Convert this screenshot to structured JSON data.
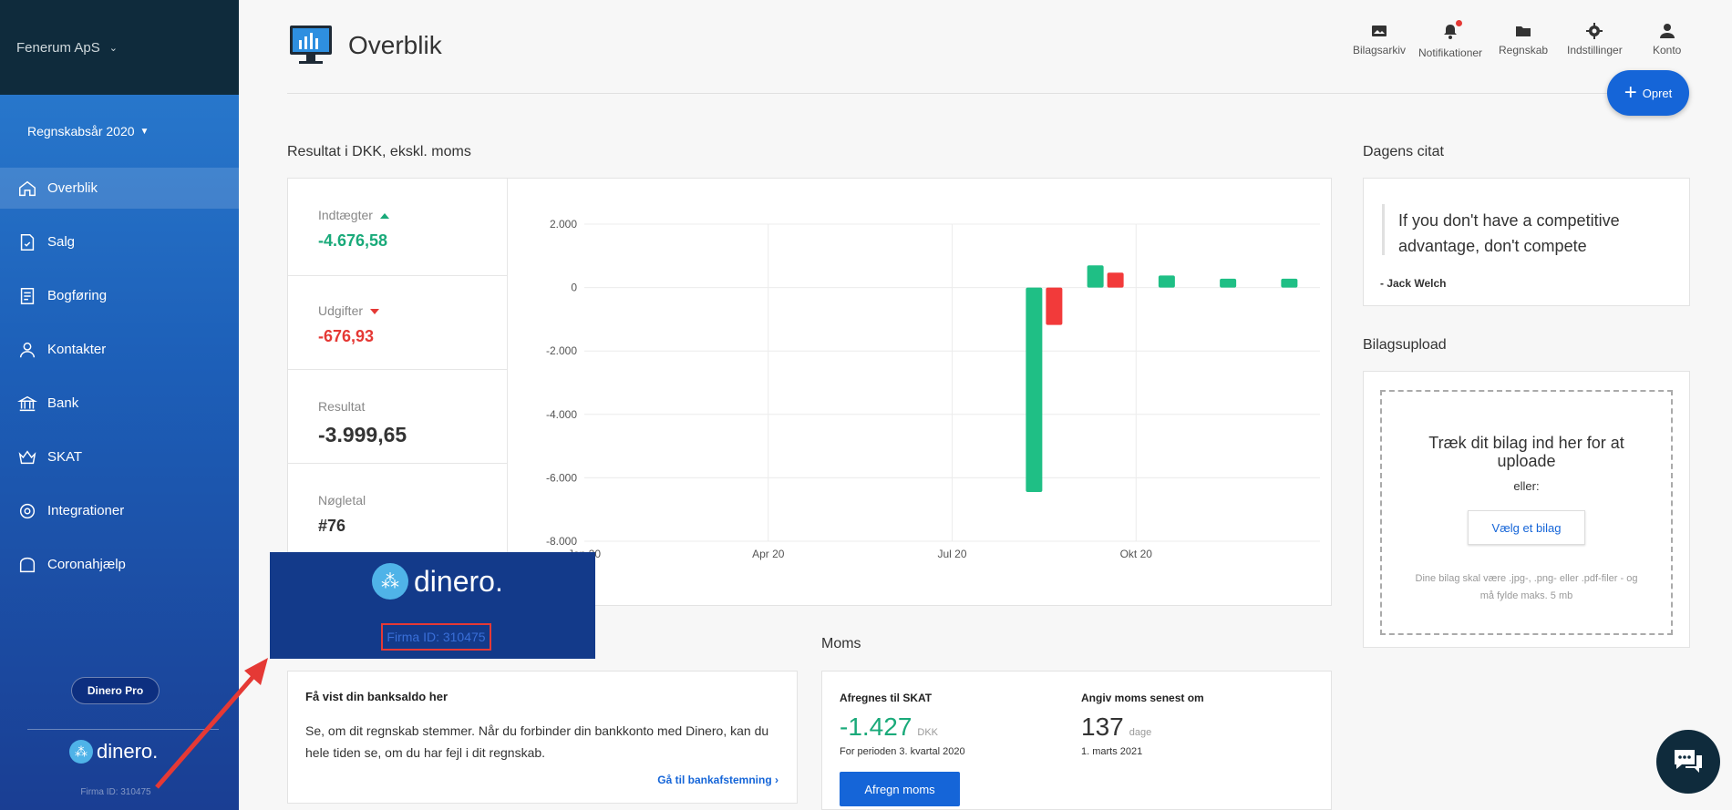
{
  "sidebar": {
    "company": "Fenerum ApS",
    "year": "Regnskabsår 2020",
    "items": [
      {
        "label": "Overblik"
      },
      {
        "label": "Salg"
      },
      {
        "label": "Bogføring"
      },
      {
        "label": "Kontakter"
      },
      {
        "label": "Bank"
      },
      {
        "label": "SKAT"
      },
      {
        "label": "Integrationer"
      },
      {
        "label": "Coronahjælp"
      }
    ],
    "pro_label": "Dinero Pro",
    "logo_text": "dinero.",
    "firm_id": "Firma ID: 310475"
  },
  "header": {
    "title": "Overblik",
    "nav": [
      {
        "label": "Bilagsarkiv",
        "icon": "archive-icon"
      },
      {
        "label": "Notifikationer",
        "icon": "bell-icon"
      },
      {
        "label": "Regnskab",
        "icon": "folder-icon"
      },
      {
        "label": "Indstillinger",
        "icon": "gear-icon"
      },
      {
        "label": "Konto",
        "icon": "user-icon"
      }
    ],
    "create_label": "Opret"
  },
  "result": {
    "section_title": "Resultat i DKK, ekskl. moms",
    "income_label": "Indtægter",
    "income_value": "-4.676,58",
    "expense_label": "Udgifter",
    "expense_value": "-676,93",
    "result_label": "Resultat",
    "result_value": "-3.999,65",
    "key_label": "Nøgletal",
    "key_value": "#76"
  },
  "chart_data": {
    "type": "bar",
    "x_tick_labels": [
      "Jan 20",
      "Apr 20",
      "Jul 20",
      "Okt 20"
    ],
    "y_tick_labels": [
      "2.000",
      "0",
      "-2.000",
      "-4.000",
      "-6.000",
      "-8.000"
    ],
    "ylim": [
      -8000,
      2000
    ],
    "grid": true,
    "series": [
      {
        "color": "#1fbf85",
        "bars": [
          {
            "month": "Aug 20",
            "value": -6450
          },
          {
            "month": "Sep 20",
            "value": 700
          },
          {
            "month": "Okt 20",
            "value": 380
          },
          {
            "month": "Nov 20",
            "value": 280
          },
          {
            "month": "Dec 20",
            "value": 280
          }
        ]
      },
      {
        "color": "#f23a3a",
        "bars": [
          {
            "month": "Aug 20",
            "value": -1180
          },
          {
            "month": "Sep 20",
            "value": 470
          }
        ]
      }
    ]
  },
  "quote": {
    "section_title": "Dagens citat",
    "text": "If you don't have a competitive advantage, don't compete",
    "author": "- Jack Welch"
  },
  "upload": {
    "section_title": "Bilagsupload",
    "drop_text": "Træk dit bilag ind her for at uploade",
    "or_text": "eller:",
    "button_label": "Vælg et bilag",
    "hint": "Dine bilag skal være .jpg-, .png- eller .pdf-filer - og må fylde maks. 5 mb"
  },
  "bank": {
    "title": "Få vist din banksaldo her",
    "text": "Se, om dit regnskab stemmer. Når du forbinder din bankkonto med Dinero, kan du hele tiden se, om du har fejl i dit regnskab.",
    "link": "Gå til bankafstemning"
  },
  "moms": {
    "section_title": "Moms",
    "settle_label": "Afregnes til SKAT",
    "settle_value": "-1.427",
    "settle_unit": "DKK",
    "settle_period": "For perioden 3. kvartal 2020",
    "deadline_label": "Angiv moms senest om",
    "deadline_value": "137",
    "deadline_unit": "dage",
    "deadline_date": "1. marts 2021",
    "button_label": "Afregn moms"
  },
  "overlay": {
    "logo_text": "dinero.",
    "firm_id": "Firma ID: 310475"
  },
  "colors": {
    "accent": "#1565d8",
    "positive": "#1aaa7a",
    "negative": "#e53935"
  }
}
